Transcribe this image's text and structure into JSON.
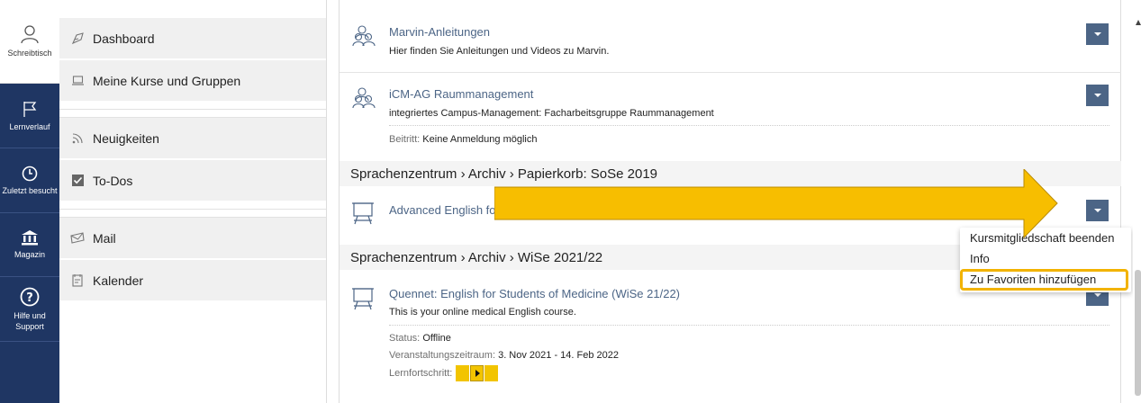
{
  "rail": [
    {
      "label": "Schreibtisch",
      "icon": "user-icon"
    },
    {
      "label": "Lernverlauf",
      "icon": "flag-icon"
    },
    {
      "label": "Zuletzt besucht",
      "icon": "clock-icon"
    },
    {
      "label": "Magazin",
      "icon": "bank-icon"
    },
    {
      "label": "Hilfe und Support",
      "icon": "help-icon"
    }
  ],
  "slate": {
    "items": [
      {
        "label": "Dashboard",
        "icon": "dashboard-icon"
      },
      {
        "label": "Meine Kurse und Gruppen",
        "icon": "laptop-icon"
      },
      {
        "label": "Neuigkeiten",
        "icon": "rss-icon"
      },
      {
        "label": "To-Dos",
        "icon": "checkbox-icon"
      },
      {
        "label": "Mail",
        "icon": "mail-icon"
      },
      {
        "label": "Kalender",
        "icon": "calendar-icon"
      }
    ]
  },
  "content": {
    "items": [
      {
        "title": "Marvin-Anleitungen",
        "desc": "Hier finden Sie Anleitungen und Videos zu Marvin."
      },
      {
        "title": "iCM-AG Raummanagement",
        "desc": "integriertes Campus-Management: Facharbeitsgruppe Raummanagement",
        "prop_key": "Beitritt:",
        "prop_val": "Keine Anmeldung möglich"
      }
    ],
    "group1": "Sprachenzentrum › Archiv › Papierkorb: SoSe 2019",
    "course1": {
      "title": "Advanced English fo"
    },
    "group2": "Sprachenzentrum › Archiv › WiSe 2021/22",
    "course2": {
      "title": "Quennet: English for Students of Medicine (WiSe 21/22)",
      "desc": "This is your online medical English course.",
      "status_key": "Status:",
      "status_val": "Offline",
      "period_key": "Veranstaltungszeitraum:",
      "period_val": "3. Nov 2021 - 14. Feb 2022",
      "progress_key": "Lernfortschritt:"
    }
  },
  "menu": {
    "items": [
      "Kursmitgliedschaft beenden",
      "Info",
      "Zu Favoriten hinzufügen"
    ]
  },
  "colors": {
    "rail": "#1f3663",
    "accent": "#4c6586",
    "highlight": "#f2b300",
    "arrow": "#f7be00"
  }
}
